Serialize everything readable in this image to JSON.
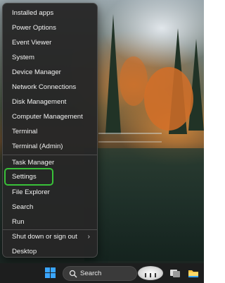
{
  "menu": {
    "items": [
      {
        "label": "Installed apps"
      },
      {
        "label": "Power Options"
      },
      {
        "label": "Event Viewer"
      },
      {
        "label": "System"
      },
      {
        "label": "Device Manager"
      },
      {
        "label": "Network Connections"
      },
      {
        "label": "Disk Management"
      },
      {
        "label": "Computer Management"
      },
      {
        "label": "Terminal"
      },
      {
        "label": "Terminal (Admin)"
      },
      {
        "label": "Task Manager"
      },
      {
        "label": "Settings"
      },
      {
        "label": "File Explorer"
      },
      {
        "label": "Search"
      },
      {
        "label": "Run"
      },
      {
        "label": "Shut down or sign out"
      },
      {
        "label": "Desktop"
      }
    ],
    "highlight_color": "#39c139"
  },
  "taskbar": {
    "search_label": "Search",
    "accent": "#3aa6ff"
  }
}
